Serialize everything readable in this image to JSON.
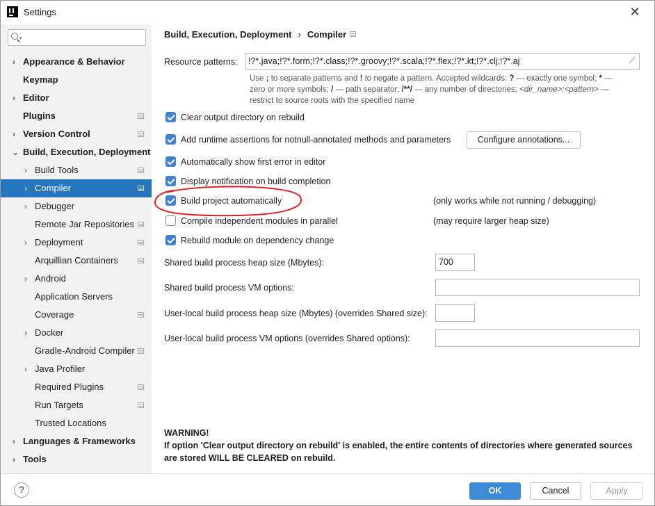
{
  "window": {
    "title": "Settings"
  },
  "search": {
    "placeholder": "",
    "value": ""
  },
  "sidebar": {
    "items": [
      {
        "label": "Appearance & Behavior",
        "expandable": true,
        "bold": true
      },
      {
        "label": "Keymap",
        "expandable": false,
        "bold": true
      },
      {
        "label": "Editor",
        "expandable": true,
        "bold": true
      },
      {
        "label": "Plugins",
        "expandable": false,
        "bold": true,
        "badge": true
      },
      {
        "label": "Version Control",
        "expandable": true,
        "bold": true,
        "badge": true
      },
      {
        "label": "Build, Execution, Deployment",
        "expanded": true,
        "bold": true
      },
      {
        "label": "Build Tools",
        "expandable": true,
        "badge": true
      },
      {
        "label": "Compiler",
        "expandable": true,
        "badge": true,
        "selected": true
      },
      {
        "label": "Debugger",
        "expandable": true
      },
      {
        "label": "Remote Jar Repositories",
        "badge": true
      },
      {
        "label": "Deployment",
        "expandable": true,
        "badge": true
      },
      {
        "label": "Arquillian Containers",
        "badge": true
      },
      {
        "label": "Android",
        "expandable": true
      },
      {
        "label": "Application Servers"
      },
      {
        "label": "Coverage",
        "badge": true
      },
      {
        "label": "Docker",
        "expandable": true
      },
      {
        "label": "Gradle-Android Compiler",
        "badge": true
      },
      {
        "label": "Java Profiler",
        "expandable": true
      },
      {
        "label": "Required Plugins",
        "badge": true
      },
      {
        "label": "Run Targets",
        "badge": true
      },
      {
        "label": "Trusted Locations"
      },
      {
        "label": "Languages & Frameworks",
        "expandable": true,
        "bold": true
      },
      {
        "label": "Tools",
        "expandable": true,
        "bold": true
      }
    ]
  },
  "breadcrumb": {
    "parent": "Build, Execution, Deployment",
    "separator": "›",
    "current": "Compiler"
  },
  "resource_patterns": {
    "label": "Resource patterns:",
    "value": "!?*.java;!?*.form;!?*.class;!?*.groovy;!?*.scala;!?*.flex;!?*.kt;!?*.clj;!?*.aj",
    "hint_line1_a": "Use ",
    "hint_line1_b": ";",
    "hint_line1_c": " to separate patterns and ",
    "hint_line1_d": "!",
    "hint_line1_e": " to negate a pattern. Accepted wildcards: ",
    "hint_line1_f": "?",
    "hint_line1_g": " — exactly one symbol; ",
    "hint_line1_h": "*",
    "hint_line1_i": " —",
    "hint_line2_a": "zero or more symbols; ",
    "hint_line2_b": "/",
    "hint_line2_c": " — path separator; ",
    "hint_line2_d": "/**/",
    "hint_line2_e": " — any number of directories; ",
    "hint_line2_f": "<dir_name>:<pattern>",
    "hint_line2_g": " —",
    "hint_line3": "restrict to source roots with the specified name"
  },
  "checkboxes": {
    "clear_output": {
      "label": "Clear output directory on rebuild",
      "checked": true
    },
    "runtime_assertions": {
      "label": "Add runtime assertions for notnull-annotated methods and parameters",
      "checked": true
    },
    "show_first_error": {
      "label": "Automatically show first error in editor",
      "checked": true
    },
    "display_notification": {
      "label": "Display notification on build completion",
      "checked": true
    },
    "build_automatically": {
      "label": "Build project automatically",
      "checked": true,
      "note": "(only works while not running / debugging)"
    },
    "compile_parallel": {
      "label": "Compile independent modules in parallel",
      "checked": false,
      "note": "(may require larger heap size)"
    },
    "rebuild_on_dependency": {
      "label": "Rebuild module on dependency change",
      "checked": true
    }
  },
  "buttons": {
    "configure_annotations": "Configure annotations...",
    "ok": "OK",
    "cancel": "Cancel",
    "apply": "Apply",
    "help": "?"
  },
  "fields": {
    "shared_heap": {
      "label": "Shared build process heap size (Mbytes):",
      "value": "700"
    },
    "shared_vm": {
      "label": "Shared build process VM options:",
      "value": ""
    },
    "user_heap": {
      "label": "User-local build process heap size (Mbytes) (overrides Shared size):",
      "value": ""
    },
    "user_vm": {
      "label": "User-local build process VM options (overrides Shared options):",
      "value": ""
    }
  },
  "warning": {
    "title": "WARNING!",
    "text": "If option 'Clear output directory on rebuild' is enabled, the entire contents of directories where generated sources are stored WILL BE CLEARED on rebuild."
  },
  "colors": {
    "accent": "#2675bf",
    "checkbox": "#3d82d5",
    "annotation": "#e02020",
    "sidebar_bg": "#f2f2f2"
  }
}
